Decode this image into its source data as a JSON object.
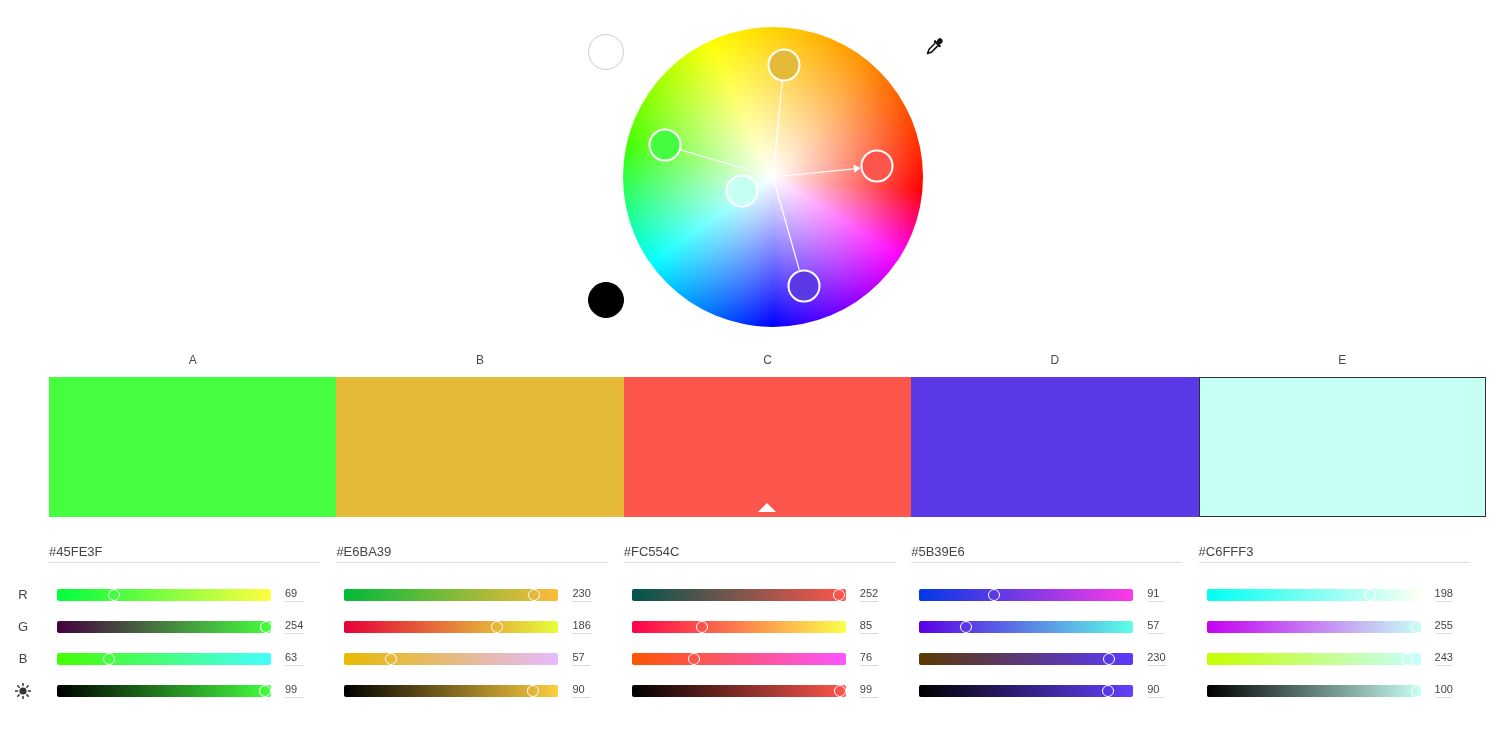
{
  "corner_swatches": [
    {
      "color": "#ffffff"
    },
    {
      "color": "#000000"
    }
  ],
  "channels": [
    {
      "kind": "red",
      "label": "R"
    },
    {
      "kind": "green",
      "label": "G"
    },
    {
      "kind": "blue",
      "label": "B"
    },
    {
      "kind": "brightness"
    }
  ],
  "swatches": [
    {
      "label": "A",
      "hex": "#45FE3F",
      "color": "#45fe3f",
      "selected": false,
      "sliders": [
        {
          "value": "69",
          "level": 0.271
        },
        {
          "value": "254",
          "level": 0.996
        },
        {
          "value": "63",
          "level": 0.247
        },
        {
          "value": "99",
          "level": 0.99
        }
      ]
    },
    {
      "label": "B",
      "hex": "#E6BA39",
      "color": "#e6ba39",
      "selected": false,
      "sliders": [
        {
          "value": "230",
          "level": 0.902
        },
        {
          "value": "186",
          "level": 0.729
        },
        {
          "value": "57",
          "level": 0.224
        },
        {
          "value": "90",
          "level": 0.9
        }
      ]
    },
    {
      "label": "C",
      "hex": "#FC554C",
      "color": "#fc554c",
      "selected": true,
      "sliders": [
        {
          "value": "252",
          "level": 0.988
        },
        {
          "value": "85",
          "level": 0.333
        },
        {
          "value": "76",
          "level": 0.298
        },
        {
          "value": "99",
          "level": 0.99
        }
      ]
    },
    {
      "label": "D",
      "hex": "#5B39E6",
      "color": "#5b39e6",
      "selected": false,
      "sliders": [
        {
          "value": "91",
          "level": 0.357
        },
        {
          "value": "57",
          "level": 0.224
        },
        {
          "value": "230",
          "level": 0.902
        },
        {
          "value": "90",
          "level": 0.9
        }
      ]
    },
    {
      "label": "E",
      "hex": "#C6FFF3",
      "color": "#c6fff3",
      "selected": false,
      "sliders": [
        {
          "value": "198",
          "level": 0.776
        },
        {
          "value": "255",
          "level": 1.0
        },
        {
          "value": "243",
          "level": 0.953
        },
        {
          "value": "100",
          "level": 1.0
        }
      ]
    }
  ]
}
